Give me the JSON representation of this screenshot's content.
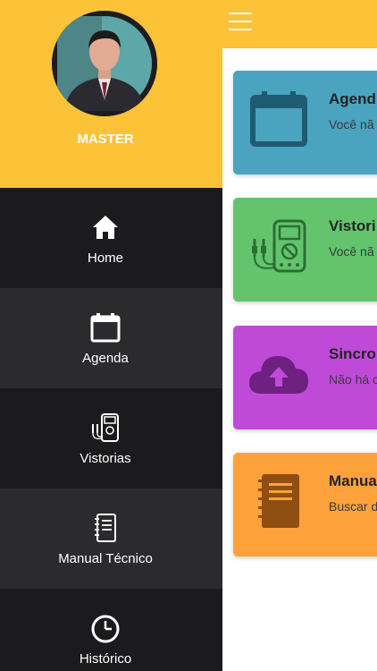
{
  "user": {
    "name": "MASTER"
  },
  "nav": {
    "items": [
      {
        "label": "Home",
        "icon": "home-icon"
      },
      {
        "label": "Agenda",
        "icon": "calendar-icon"
      },
      {
        "label": "Vistorias",
        "icon": "multimeter-icon"
      },
      {
        "label": "Manual Técnico",
        "icon": "notebook-icon"
      },
      {
        "label": "Histórico",
        "icon": "clock-icon"
      }
    ]
  },
  "cards": [
    {
      "title": "Agend",
      "desc": "Você nã atualiza",
      "color": "#4aa3bf",
      "icon": "calendar-icon"
    },
    {
      "title": "Vistori",
      "desc": "Você nã",
      "color": "#63c46d",
      "icon": "multimeter-icon"
    },
    {
      "title": "Sincro",
      "desc": "Não há com o s",
      "color": "#c04ad8",
      "icon": "cloud-upload-icon"
    },
    {
      "title": "Manua",
      "desc": "Buscar dos dis",
      "color": "#fda23a",
      "icon": "notebook-icon"
    }
  ],
  "colors": {
    "accent": "#fcc238",
    "drawer_dark": "#1b1b1d",
    "drawer_alt": "#2b2b2d"
  }
}
